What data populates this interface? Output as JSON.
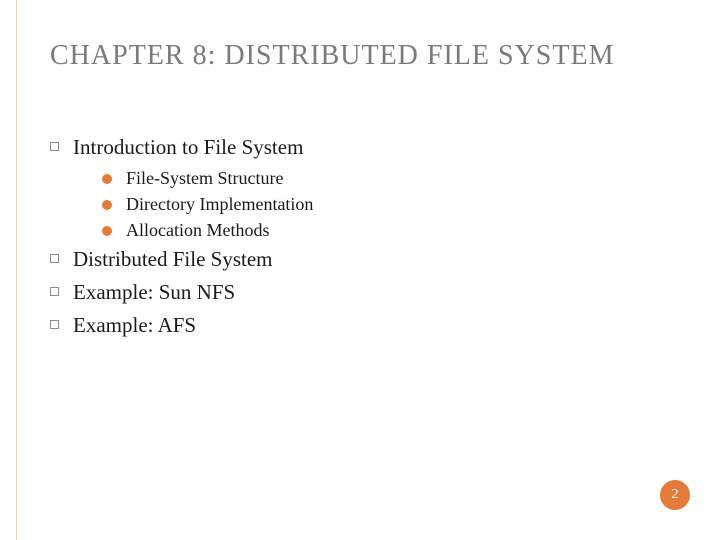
{
  "slide": {
    "title": "CHAPTER 8: DISTRIBUTED FILE SYSTEM",
    "page_number": "2",
    "outline": [
      {
        "label": "Introduction to File System",
        "children": [
          {
            "label": "File-System Structure"
          },
          {
            "label": "Directory Implementation"
          },
          {
            "label": "Allocation Methods"
          }
        ]
      },
      {
        "label": "Distributed File System",
        "children": []
      },
      {
        "label": "Example: Sun NFS",
        "children": []
      },
      {
        "label": "Example: AFS",
        "children": []
      }
    ]
  }
}
